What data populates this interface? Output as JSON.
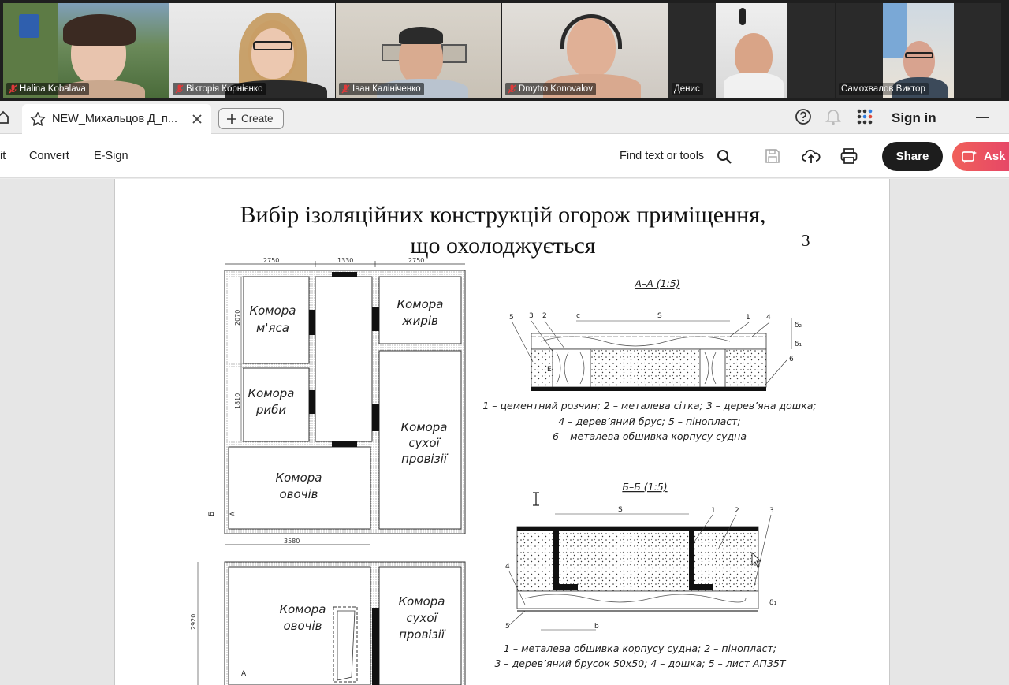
{
  "meeting": {
    "participants": [
      {
        "name": "Halina Kobalava",
        "muted": true
      },
      {
        "name": "Вікторія Корнієнко",
        "muted": true
      },
      {
        "name": "Іван Калініченко",
        "muted": true
      },
      {
        "name": "Dmytro Konovalov",
        "muted": true
      },
      {
        "name": "Денис",
        "muted": false,
        "active": true
      },
      {
        "name": "Самохвалов Виктор",
        "muted": false
      }
    ],
    "colors": {
      "active_border": "#23d18b",
      "mute_icon": "#e03a3a"
    }
  },
  "tabbar": {
    "tab_title": "NEW_Михальцов Д_п...",
    "create_label": "Create",
    "signin_label": "Sign in"
  },
  "toolbar": {
    "edit_label": "it",
    "convert_label": "Convert",
    "esign_label": "E-Sign",
    "find_label": "Find text or tools",
    "share_label": "Share",
    "ask_label": "Ask",
    "colors": {
      "share_bg": "#1d1d1d",
      "ask_bg": "#e94f63"
    }
  },
  "document": {
    "title_line1": "Вибір ізоляційних конструкцій огорож приміщення,",
    "title_line2": "що охолоджується",
    "page_number": "3",
    "plan": {
      "rooms": {
        "meat": [
          "Комора",
          "м'яса"
        ],
        "fats": [
          "Комора",
          "жирів"
        ],
        "fish": [
          "Комора",
          "риби"
        ],
        "dry": [
          "Комора",
          "сухої",
          "провізії"
        ],
        "veg": [
          "Комора",
          "овочів"
        ],
        "veg2": [
          "Комора",
          "овочів"
        ],
        "dry2": [
          "Комора",
          "сухої",
          "провізії"
        ]
      },
      "dims": {
        "top_left": "2750",
        "top_mid": "1330",
        "top_right": "2750",
        "left1": "2070",
        "left2": "1810",
        "bottom": "3580",
        "left3": "2920"
      },
      "marks": {
        "b": "Б",
        "a": "А"
      }
    },
    "section_aa": {
      "title": "А–А (1:5)",
      "labels": {
        "n5": "5",
        "n3": "3",
        "n2": "2",
        "n1": "1",
        "n4": "4",
        "n6": "6",
        "c": "c",
        "s": "S",
        "d2": "δ₂",
        "d1": "δ₁",
        "e": "E"
      },
      "legend": [
        "1 – цементний розчин; 2 – металева сітка; 3 – дерев’яна дошка;",
        "4 – дерев’яний брус; 5 – пінопласт;",
        "6 – металева обшивка корпусу судна"
      ]
    },
    "section_bb": {
      "title": "Б–Б (1:5)",
      "labels": {
        "n1": "1",
        "n2": "2",
        "n3": "3",
        "n4": "4",
        "n5": "5",
        "s": "S",
        "b": "b",
        "d": "δ₁"
      },
      "legend": [
        "1 – металева обшивка корпусу судна; 2 – пінопласт;",
        "3 – дерев’яний брусок 50х50; 4 – дошка; 5 – лист АП35Т"
      ]
    }
  }
}
